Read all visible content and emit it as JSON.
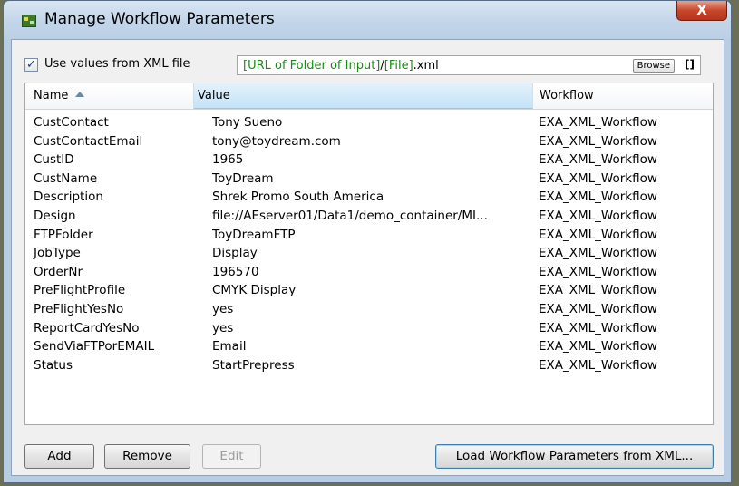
{
  "window": {
    "title": "Manage Workflow Parameters",
    "close_label": "X",
    "app_icon": "workflow-app-icon"
  },
  "xml_source": {
    "checkbox_checked": true,
    "checkbox_mark": "✓",
    "label": "Use values from XML file",
    "path_parts": [
      "[URL of Folder of Input]",
      "/",
      "[File]",
      ".xml"
    ],
    "browse_label": "Browse",
    "bracket_label": "[]"
  },
  "table": {
    "columns": {
      "name": "Name",
      "value": "Value",
      "workflow": "Workflow"
    },
    "sort_column": "name",
    "sort_direction": "ascending",
    "rows": [
      {
        "name": "CustContact",
        "value": "Tony Sueno",
        "workflow": "EXA_XML_Workflow"
      },
      {
        "name": "CustContactEmail",
        "value": "tony@toydream.com",
        "workflow": "EXA_XML_Workflow"
      },
      {
        "name": "CustID",
        "value": "1965",
        "workflow": "EXA_XML_Workflow"
      },
      {
        "name": "CustName",
        "value": "ToyDream",
        "workflow": "EXA_XML_Workflow"
      },
      {
        "name": "Description",
        "value": "Shrek Promo South America",
        "workflow": "EXA_XML_Workflow"
      },
      {
        "name": "Design",
        "value": "file://AEserver01/Data1/demo_container/MI...",
        "workflow": "EXA_XML_Workflow"
      },
      {
        "name": "FTPFolder",
        "value": "ToyDreamFTP",
        "workflow": "EXA_XML_Workflow"
      },
      {
        "name": "JobType",
        "value": "Display",
        "workflow": "EXA_XML_Workflow"
      },
      {
        "name": "OrderNr",
        "value": "196570",
        "workflow": "EXA_XML_Workflow"
      },
      {
        "name": "PreFlightProfile",
        "value": "CMYK Display",
        "workflow": "EXA_XML_Workflow"
      },
      {
        "name": "PreFlightYesNo",
        "value": "yes",
        "workflow": "EXA_XML_Workflow"
      },
      {
        "name": "ReportCardYesNo",
        "value": "yes",
        "workflow": "EXA_XML_Workflow"
      },
      {
        "name": "SendViaFTPorEMAIL",
        "value": "Email",
        "workflow": "EXA_XML_Workflow"
      },
      {
        "name": "Status",
        "value": "StartPrepress",
        "workflow": "EXA_XML_Workflow"
      }
    ]
  },
  "buttons": {
    "add": "Add",
    "remove": "Remove",
    "edit": "Edit",
    "edit_enabled": false,
    "load": "Load Workflow Parameters from XML..."
  },
  "colors": {
    "path_token": "#1b8a16",
    "close_button": "#c7472a",
    "selected_header": "#c3e3f7"
  }
}
